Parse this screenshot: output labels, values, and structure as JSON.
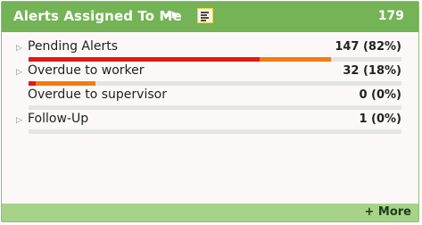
{
  "widget": {
    "title": "Alerts Assigned To Me",
    "nav_prev": "◀",
    "nav_next": "▶",
    "total": "179",
    "more_label": "+ More"
  },
  "rows": [
    {
      "label": "Pending Alerts",
      "value": "147 (82%)",
      "expandable": true,
      "bar": {
        "red": 0.62,
        "orange": 0.19
      }
    },
    {
      "label": "Overdue to worker",
      "value": "32 (18%)",
      "expandable": true,
      "bar": {
        "red": 0.02,
        "orange": 0.16
      }
    },
    {
      "label": "Overdue to supervisor",
      "value": "0 (0%)",
      "expandable": false,
      "bar": {
        "red": 0,
        "orange": 0
      }
    },
    {
      "label": "Follow-Up",
      "value": "1 (0%)",
      "expandable": true,
      "bar": {
        "red": 0,
        "orange": 0
      }
    }
  ],
  "colors": {
    "header": "#74b356",
    "footer": "#a7d389",
    "bar_red": "#e11a14",
    "bar_orange": "#f27c12",
    "track": "#e4e4e4"
  },
  "icons": {
    "prev": "chevron-left-icon",
    "next": "chevron-right-icon",
    "list": "list-view-icon",
    "expand": "expand-triangle-icon"
  }
}
